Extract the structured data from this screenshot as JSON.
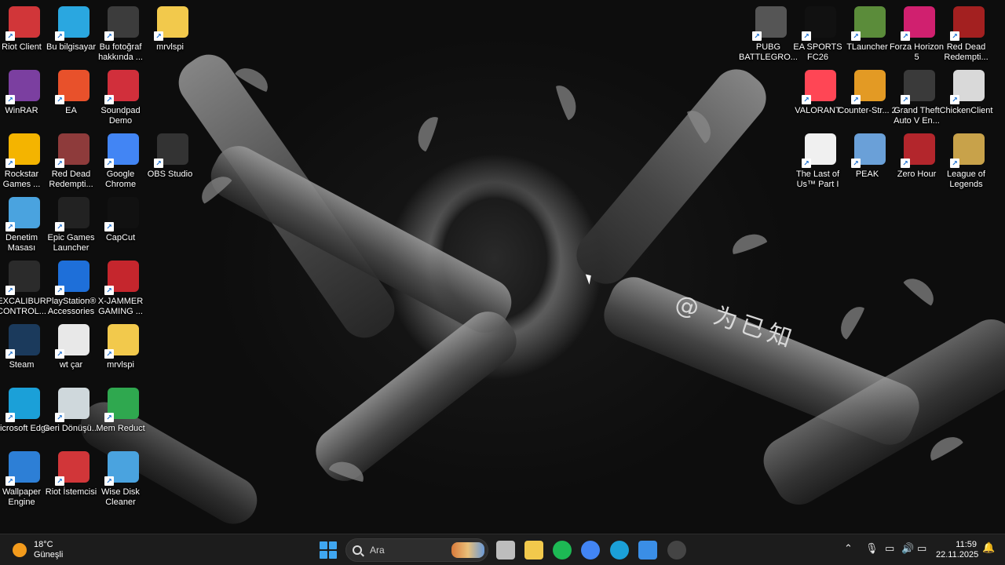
{
  "desktop": {
    "watermark": "@ 为已知",
    "icons": [
      {
        "label": "Riot Client",
        "glyph": "riot-fist-icon",
        "color": "#d13639"
      },
      {
        "label": "Bu bilgisayar",
        "glyph": "monitor-icon",
        "color": "#2aa7e0"
      },
      {
        "label": "Bu fotoğraf hakkında ...",
        "glyph": "camera-info-icon",
        "color": "#3c3c3c"
      },
      {
        "label": "mrvlspi",
        "glyph": "folder-icon",
        "color": "#f2c94c"
      },
      {
        "label": "WinRAR",
        "glyph": "winrar-icon",
        "color": "#7b3fa0"
      },
      {
        "label": "EA",
        "glyph": "ea-icon",
        "color": "#e8512b"
      },
      {
        "label": "Soundpad Demo",
        "glyph": "play-icon",
        "color": "#d12f3b"
      },
      {
        "label": "Rockstar Games ...",
        "glyph": "rockstar-icon",
        "color": "#f4b400"
      },
      {
        "label": "Red Dead Redempti...",
        "glyph": "winrar-icon",
        "color": "#8e3b3b"
      },
      {
        "label": "Google Chrome",
        "glyph": "chrome-icon",
        "color": "#4285f4"
      },
      {
        "label": "OBS Studio",
        "glyph": "obs-icon",
        "color": "#333333"
      },
      {
        "label": "Denetim Masası",
        "glyph": "control-panel-icon",
        "color": "#4aa3df"
      },
      {
        "label": "Epic Games Launcher",
        "glyph": "epic-icon",
        "color": "#222222"
      },
      {
        "label": "CapCut",
        "glyph": "capcut-icon",
        "color": "#111111"
      },
      {
        "label": "EXCALIBUR CONTROL...",
        "glyph": "excalibur-icon",
        "color": "#2b2b2b"
      },
      {
        "label": "PlayStation® Accessories",
        "glyph": "playstation-icon",
        "color": "#1e6fd9"
      },
      {
        "label": "X-JAMMER GAMING ...",
        "glyph": "xjammer-icon",
        "color": "#c5262d"
      },
      {
        "label": "Steam",
        "glyph": "steam-icon",
        "color": "#1b3a5c"
      },
      {
        "label": "wt çar",
        "glyph": "document-icon",
        "color": "#e8e8e8"
      },
      {
        "label": "mrvlspi",
        "glyph": "folder-icon",
        "color": "#f2c94c"
      },
      {
        "label": "Microsoft Edge",
        "glyph": "edge-icon",
        "color": "#1ba0d8"
      },
      {
        "label": "Geri Dönüşü...",
        "glyph": "recycle-bin-icon",
        "color": "#cfd8dc"
      },
      {
        "label": "Mem Reduct",
        "glyph": "memory-icon",
        "color": "#2fa84f"
      },
      {
        "label": "Wallpaper Engine",
        "glyph": "wallpaper-engine-icon",
        "color": "#2d7fd6"
      },
      {
        "label": "Riot İstemcisi",
        "glyph": "riot-fist-icon",
        "color": "#d13639"
      },
      {
        "label": "Wise Disk Cleaner",
        "glyph": "disk-cleaner-icon",
        "color": "#4aa3df"
      },
      {
        "label": "PUBG BATTLEGRO...",
        "glyph": "pubg-icon",
        "color": "#555555"
      },
      {
        "label": "EA SPORTS FC26",
        "glyph": "fc26-icon",
        "color": "#111111"
      },
      {
        "label": "TLauncher",
        "glyph": "minecraft-icon",
        "color": "#5b8c3a"
      },
      {
        "label": "Forza Horizon 5",
        "glyph": "forza-icon",
        "color": "#d0206f"
      },
      {
        "label": "Red Dead Redempti...",
        "glyph": "rdr-icon",
        "color": "#a32020"
      },
      {
        "label": "VALORANT",
        "glyph": "valorant-icon",
        "color": "#ff4655"
      },
      {
        "label": "Counter-Str... 2",
        "glyph": "cs2-icon",
        "color": "#e39a24"
      },
      {
        "label": "Grand Theft Auto V En...",
        "glyph": "gta-icon",
        "color": "#3a3a3a"
      },
      {
        "label": "ChickenClient",
        "glyph": "chicken-icon",
        "color": "#d9d9d9"
      },
      {
        "label": "The Last of Us™ Part I",
        "glyph": "document-icon",
        "color": "#f0f0f0"
      },
      {
        "label": "PEAK",
        "glyph": "peak-icon",
        "color": "#6aa0d8"
      },
      {
        "label": "Zero Hour",
        "glyph": "zero-hour-icon",
        "color": "#b3262c"
      },
      {
        "label": "League of Legends",
        "glyph": "lol-icon",
        "color": "#c8a24a"
      }
    ]
  },
  "taskbar": {
    "weather": {
      "temp": "18°C",
      "condition": "Güneşli"
    },
    "search_placeholder": "Ara",
    "apps": [
      {
        "name": "task-view-button",
        "color": "#bdbdbd"
      },
      {
        "name": "file-explorer-button",
        "color": "#f2c94c"
      },
      {
        "name": "spotify-button",
        "color": "#1db954"
      },
      {
        "name": "chrome-button",
        "color": "#4285f4"
      },
      {
        "name": "edge-button",
        "color": "#1ba0d8"
      },
      {
        "name": "store-button",
        "color": "#3a8ee6"
      },
      {
        "name": "obs-button",
        "color": "#444444"
      }
    ],
    "clock": {
      "time": "11:59",
      "date": "22.11.2025"
    }
  }
}
